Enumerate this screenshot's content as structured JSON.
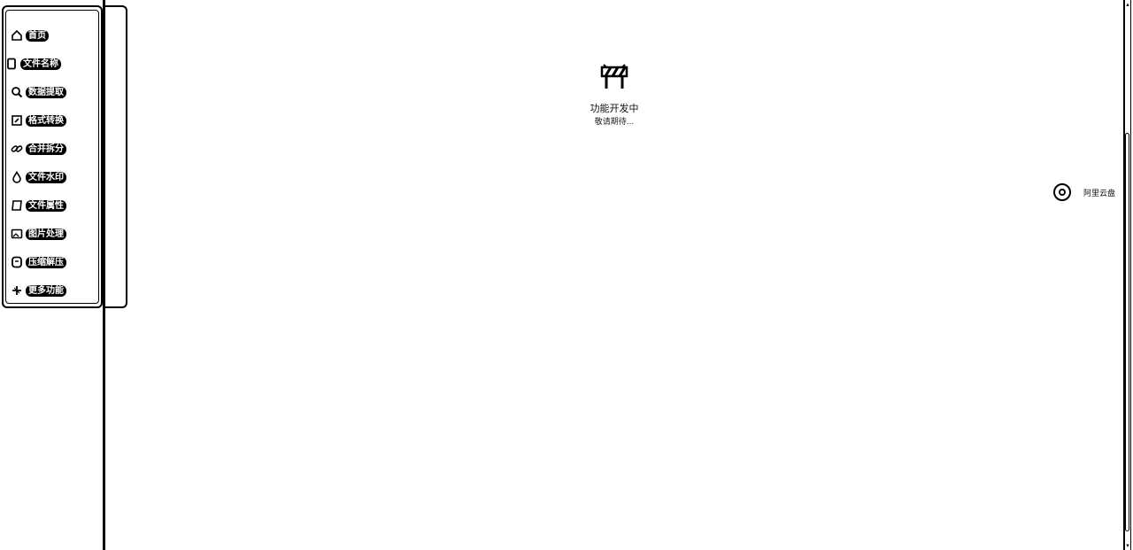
{
  "sidebar": {
    "items": [
      {
        "label": "首页",
        "icon": "home-icon"
      },
      {
        "label": "文件名称",
        "icon": "document-icon"
      },
      {
        "label": "数据提取",
        "icon": "search-icon"
      },
      {
        "label": "格式转换",
        "icon": "convert-icon"
      },
      {
        "label": "合并拆分",
        "icon": "link-icon"
      },
      {
        "label": "文件水印",
        "icon": "droplet-icon"
      },
      {
        "label": "文件属性",
        "icon": "file-props-icon"
      },
      {
        "label": "图片处理",
        "icon": "image-icon"
      },
      {
        "label": "压缩解压",
        "icon": "archive-icon"
      },
      {
        "label": "更多功能",
        "icon": "plus-icon"
      }
    ]
  },
  "main": {
    "status_title": "功能开发中",
    "status_subtitle": "敬请期待...",
    "status_icon": "barrier-icon"
  },
  "floating": {
    "cloud_label": "阿里云盘",
    "cloud_icon": "cloud-drive-icon"
  }
}
